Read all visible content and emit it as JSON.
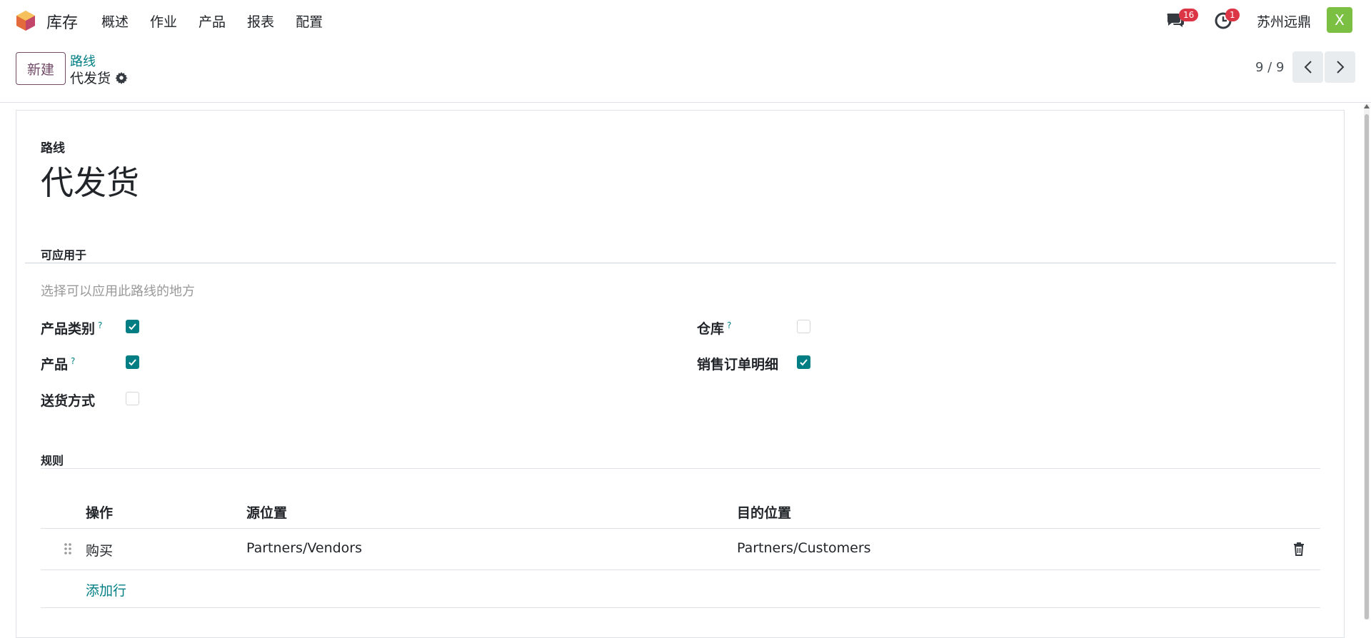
{
  "navbar": {
    "app_name": "库存",
    "menu": [
      "概述",
      "作业",
      "产品",
      "报表",
      "配置"
    ],
    "messages_count": "16",
    "activities_count": "1",
    "company": "苏州远鼎",
    "avatar_initial": "X"
  },
  "control": {
    "new_label": "新建",
    "breadcrumb_parent": "路线",
    "breadcrumb_current": "代发货",
    "pager": "9 / 9"
  },
  "form": {
    "route_label": "路线",
    "route_name": "代发货",
    "applicable_title": "可应用于",
    "applicable_helper": "选择可以应用此路线的地方",
    "fields": {
      "product_category": {
        "label": "产品类别",
        "help": "?",
        "checked": true
      },
      "product": {
        "label": "产品",
        "help": "?",
        "checked": true
      },
      "shipping_method": {
        "label": "送货方式",
        "checked": false
      },
      "warehouse": {
        "label": "仓库",
        "help": "?",
        "checked": false
      },
      "sale_order_line": {
        "label": "销售订单明细",
        "checked": true
      }
    },
    "rules_title": "规则",
    "rules_table": {
      "headers": [
        "操作",
        "源位置",
        "目的位置"
      ],
      "rows": [
        {
          "action": "购买",
          "source": "Partners/Vendors",
          "destination": "Partners/Customers"
        }
      ],
      "add_line": "添加行"
    }
  },
  "colors": {
    "accent": "#017e84",
    "brand": "#714b67",
    "badge": "#dc3545",
    "avatar": "#7bc043"
  }
}
